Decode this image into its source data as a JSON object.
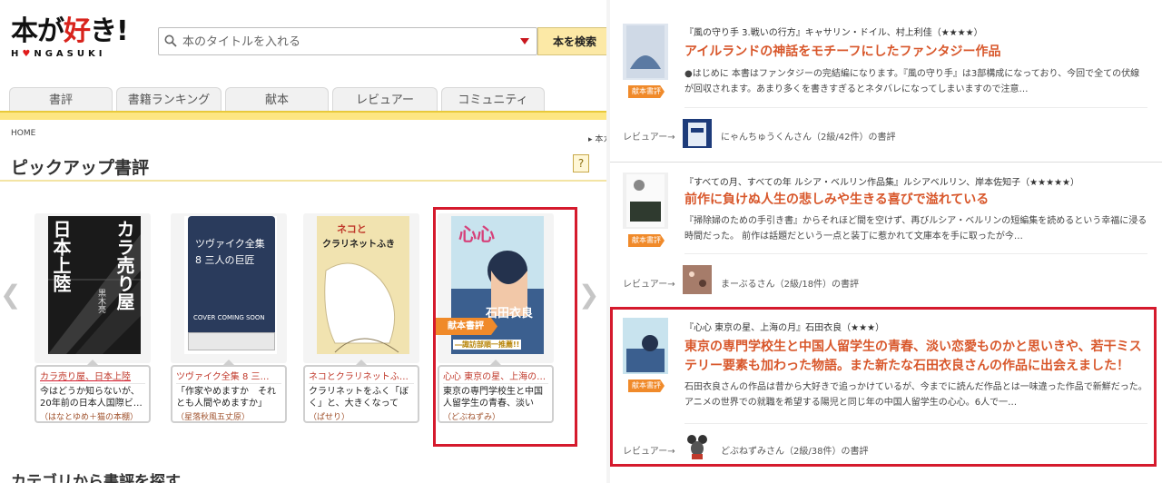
{
  "logo": {
    "main_a": "本が",
    "main_b": "好",
    "main_c": "き!",
    "sub_a": "H",
    "sub_heart": "♥",
    "sub_b": "NGASUKI"
  },
  "search": {
    "placeholder": "本のタイトルを入れる",
    "button": "本を検索"
  },
  "nav": {
    "tabs": [
      "書評",
      "書籍ランキング",
      "献本",
      "レビュアー",
      "コミュニティ"
    ]
  },
  "breadcrumb": {
    "home": "HOME",
    "right": "▸ 本ガ"
  },
  "section": {
    "title": "ピックアップ書評",
    "help": "?"
  },
  "pickups": [
    {
      "cover_title": "カラ売り屋",
      "cover_title2": "日本上陸",
      "cover_author": "黒木亮",
      "title": "カラ売り屋、日本上陸",
      "text": "今はどうか知らないが、20年前の日本人国際ビ…",
      "user": "（はなとゆめ＋猫の本棚）"
    },
    {
      "cover_title": "ツヴァイク全集",
      "cover_title2": "8 三人の巨匠",
      "cover_note": "COVER COMING SOON",
      "title": "ツヴァイク全集 8 三…",
      "text": "「作家やめますか　それとも人間やめますか」",
      "user": "（星落秋風五丈原）"
    },
    {
      "cover_title": "ネコと",
      "cover_title2": "クラリネットふき",
      "title": "ネコとクラリネットふき…",
      "text": "クラリネットをふく「ぼく」と、大きくなってい…",
      "user": "（ぱせり）"
    },
    {
      "cover_title": "心心",
      "cover_author": "石田衣良",
      "cover_banner": "―諏訪部順一推薦!!",
      "title": "心心 東京の星、上海の…",
      "text": "東京の専門学校生と中国人留学生の青春、淡い恋…",
      "user": "（どぶねずみ）",
      "badge": "献本書評"
    }
  ],
  "categories_title": "カテゴリから書評を探す",
  "reviews": [
    {
      "meta": "『風の守り手 3.戦いの行方』キャサリン・ドイル、村上利佳（★★★★）",
      "headline": "アイルランドの神話をモチーフにしたファンタジー作品",
      "body": "●はじめに 本書はファンタジーの完結編になります。『風の守り手』は3部構成になっており、今回で全ての伏線が回収されます。あまり多くを書きすぎるとネタバレになってしまいますので注意…",
      "badge": "献本書評",
      "reviewer_label": "レビュアー→",
      "reviewer": "にゃんちゅうくんさん（2級/42件）の書評"
    },
    {
      "meta": "『すべての月、すべての年 ルシア・ベルリン作品集』ルシアベルリン、岸本佐知子（★★★★★）",
      "headline": "前作に負けぬ人生の悲しみや生きる喜びで溢れている",
      "body": "『掃除婦のための手引き書』からそれほど間を空けず、再びルシア・ベルリンの短編集を読めるという幸福に浸る時間だった。 前作は話題だという一点と装丁に惹かれて文庫本を手に取ったが今…",
      "badge": "献本書評",
      "reviewer_label": "レビュアー→",
      "reviewer": "まーぶるさん（2級/18件）の書評"
    },
    {
      "meta": "『心心 東京の星、上海の月』石田衣良（★★★）",
      "headline": "東京の専門学校生と中国人留学生の青春、淡い恋愛ものかと思いきや、若干ミステリー要素も加わった物語。また新たな石田衣良さんの作品に出会えました！",
      "body": "石田衣良さんの作品は昔から大好きで追っかけているが、今までに読んだ作品とは一味違った作品で新鮮だった。 アニメの世界での就職を希望する陽児と同じ年の中国人留学生の心心。6人で一…",
      "badge": "献本書評",
      "reviewer_label": "レビュアー→",
      "reviewer": "どぶねずみさん（2級/38件）の書評"
    }
  ],
  "colors": {
    "accent_red": "#d51a2d",
    "headline_orange": "#d8572b",
    "nav_yellow": "#fde682",
    "badge_orange": "#f08a2a"
  }
}
